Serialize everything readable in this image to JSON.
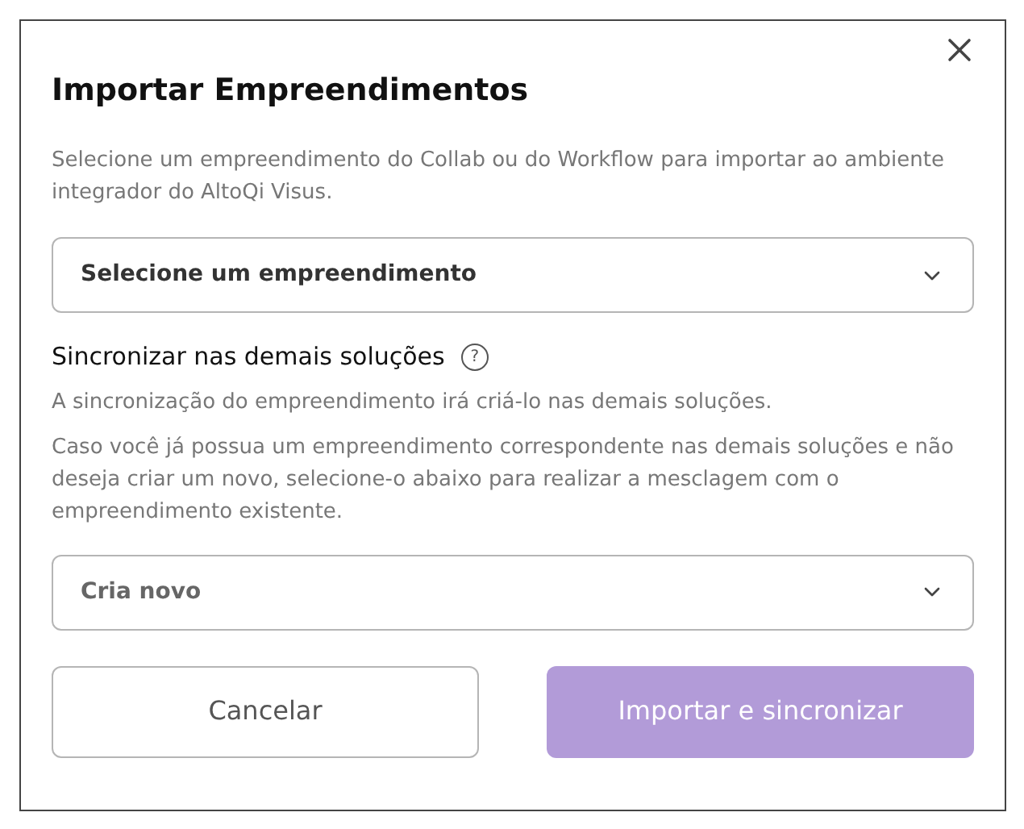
{
  "dialog": {
    "title": "Importar Empreendimentos",
    "description": "Selecione um empreendimento do Collab ou do Workflow para importar ao ambiente integrador do AltoQi Visus.",
    "project_select": {
      "value": "Selecione um empreendimento"
    },
    "sync": {
      "heading": "Sincronizar nas demais soluções",
      "help_icon": "?",
      "info": "A sincronização do empreendimento irá criá-lo nas demais soluções.",
      "details": "Caso você já possua um empreendimento correspondente nas demais soluções e não deseja criar um novo, selecione-o abaixo para realizar a mesclagem com o empreendimento existente."
    },
    "merge_select": {
      "value": "Cria novo"
    },
    "buttons": [
      {
        "label": "Cancelar",
        "kind": "secondary",
        "disabled": false
      },
      {
        "label": "Importar e sincronizar",
        "kind": "primary",
        "disabled": true
      }
    ]
  }
}
